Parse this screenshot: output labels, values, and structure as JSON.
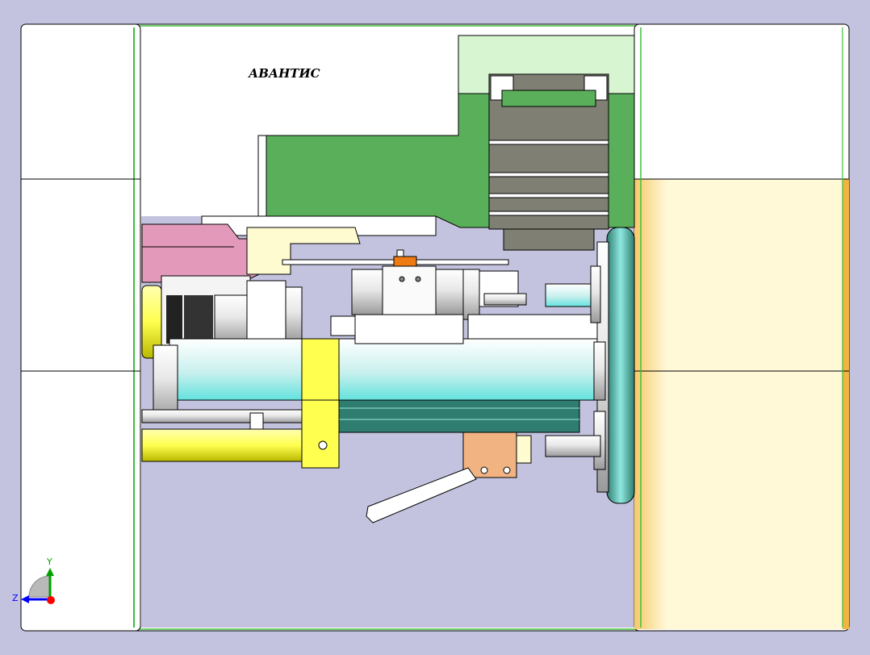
{
  "canvas": {
    "background": "#c3c3df",
    "logo_text": "АВАНТИС"
  },
  "triad": {
    "y_label": "Y",
    "z_label": "Z",
    "x_color": "#ff0000",
    "y_color": "#00a000",
    "z_color": "#0000ff"
  },
  "colors": {
    "frame_white": "#ffffff",
    "frame_cream": "#fff9d8",
    "edge_green": "#3cbf3c",
    "carriage_green": "#5aaf5a",
    "carriage_light": "#d8f5d2",
    "block_gray": "#7f7f74",
    "ways_teal": "#2f7d70",
    "spindle_cyan": "#63e2de",
    "yellow": "#ffff50",
    "pink": "#e39aba",
    "orange": "#ee7a14",
    "tan": "#f1b381"
  }
}
